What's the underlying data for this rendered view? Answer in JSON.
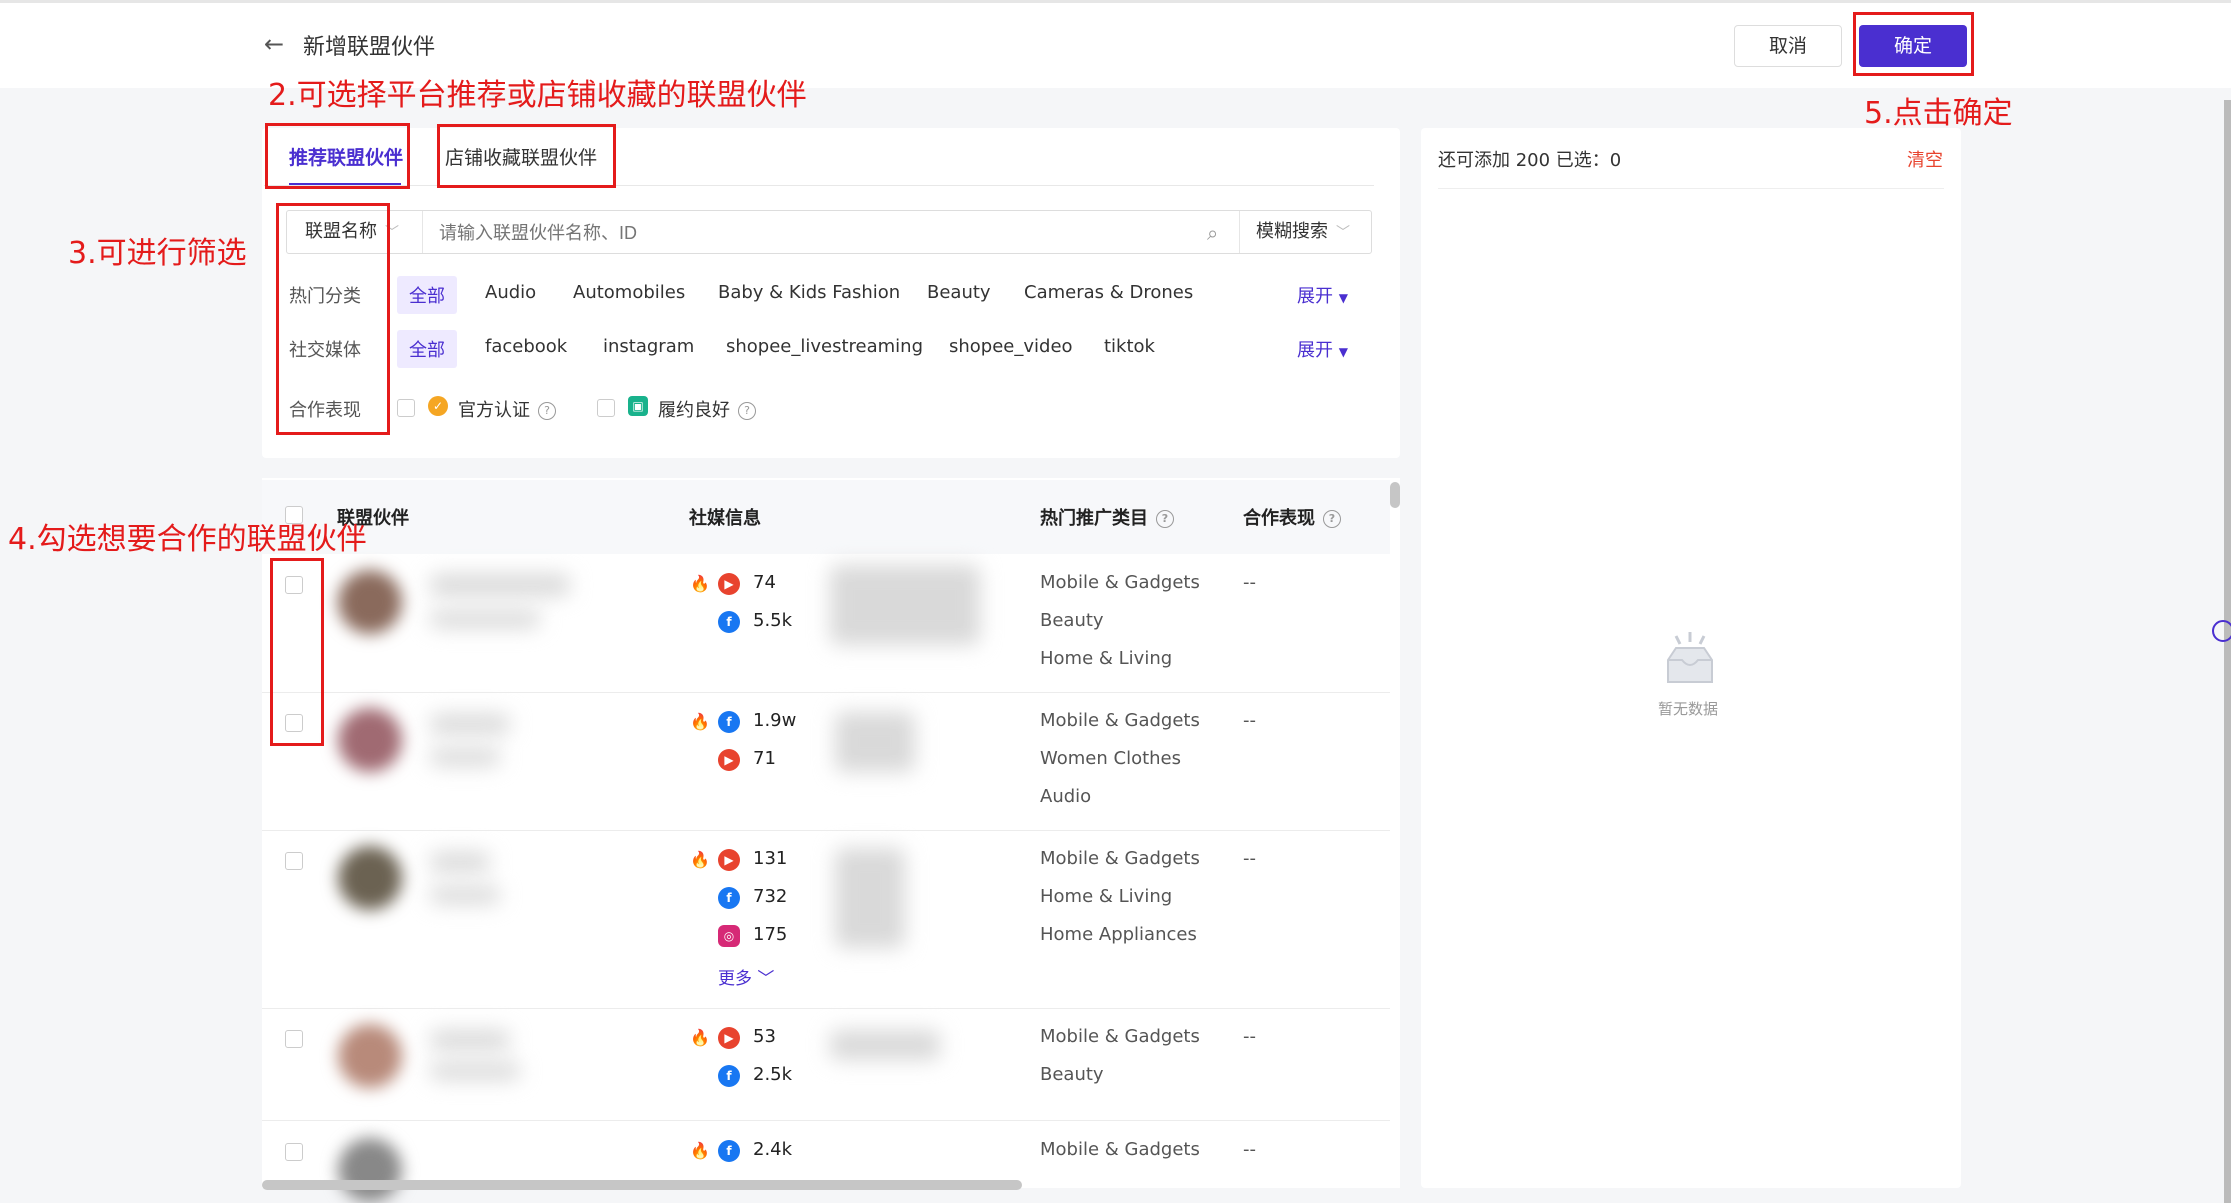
{
  "header": {
    "title": "新增联盟伙伴",
    "cancel_label": "取消",
    "confirm_label": "确定"
  },
  "tabs": [
    {
      "label": "推荐联盟伙伴",
      "active": true
    },
    {
      "label": "店铺收藏联盟伙伴",
      "active": false
    }
  ],
  "search": {
    "type_label": "联盟名称",
    "placeholder": "请输入联盟伙伴名称、ID",
    "mode_label": "模糊搜索"
  },
  "filters": {
    "category": {
      "label": "热门分类",
      "options": [
        "全部",
        "Audio",
        "Automobiles",
        "Baby & Kids Fashion",
        "Beauty",
        "Cameras & Drones"
      ],
      "expand_label": "展开"
    },
    "social": {
      "label": "社交媒体",
      "options": [
        "全部",
        "facebook",
        "instagram",
        "shopee_livestreaming",
        "shopee_video",
        "tiktok"
      ],
      "expand_label": "展开"
    },
    "performance": {
      "label": "合作表现",
      "options": [
        "官方认证",
        "履约良好"
      ]
    }
  },
  "table": {
    "columns": [
      "联盟伙伴",
      "社媒信息",
      "热门推广类目",
      "合作表现"
    ],
    "rows": [
      {
        "stats": [
          {
            "platform": "youtube",
            "value": "74"
          },
          {
            "platform": "facebook",
            "value": "5.5k"
          }
        ],
        "categories": [
          "Mobile & Gadgets",
          "Beauty",
          "Home & Living"
        ],
        "performance": "--"
      },
      {
        "stats": [
          {
            "platform": "facebook",
            "value": "1.9w"
          },
          {
            "platform": "youtube",
            "value": "71"
          }
        ],
        "categories": [
          "Mobile & Gadgets",
          "Women Clothes",
          "Audio"
        ],
        "performance": "--"
      },
      {
        "stats": [
          {
            "platform": "youtube",
            "value": "131"
          },
          {
            "platform": "facebook",
            "value": "732"
          },
          {
            "platform": "instagram",
            "value": "175"
          }
        ],
        "categories": [
          "Mobile & Gadgets",
          "Home & Living",
          "Home Appliances"
        ],
        "performance": "--",
        "more_label": "更多"
      },
      {
        "stats": [
          {
            "platform": "youtube",
            "value": "53"
          },
          {
            "platform": "facebook",
            "value": "2.5k"
          }
        ],
        "categories": [
          "Mobile & Gadgets",
          "Beauty"
        ],
        "performance": "--"
      },
      {
        "stats": [
          {
            "platform": "facebook",
            "value": "2.4k"
          }
        ],
        "categories": [
          "Mobile & Gadgets"
        ],
        "performance": "--"
      }
    ]
  },
  "selection": {
    "summary": "还可添加 200 已选：0",
    "clear_label": "清空",
    "empty_text": "暂无数据"
  },
  "annotations": [
    "2.可选择平台推荐或店铺收藏的联盟伙伴",
    "3.可进行筛选",
    "4.勾选想要合作的联盟伙伴",
    "5.点击确定"
  ],
  "colors": {
    "accent": "#4a2fd0",
    "annotation": "#e41b1b"
  }
}
